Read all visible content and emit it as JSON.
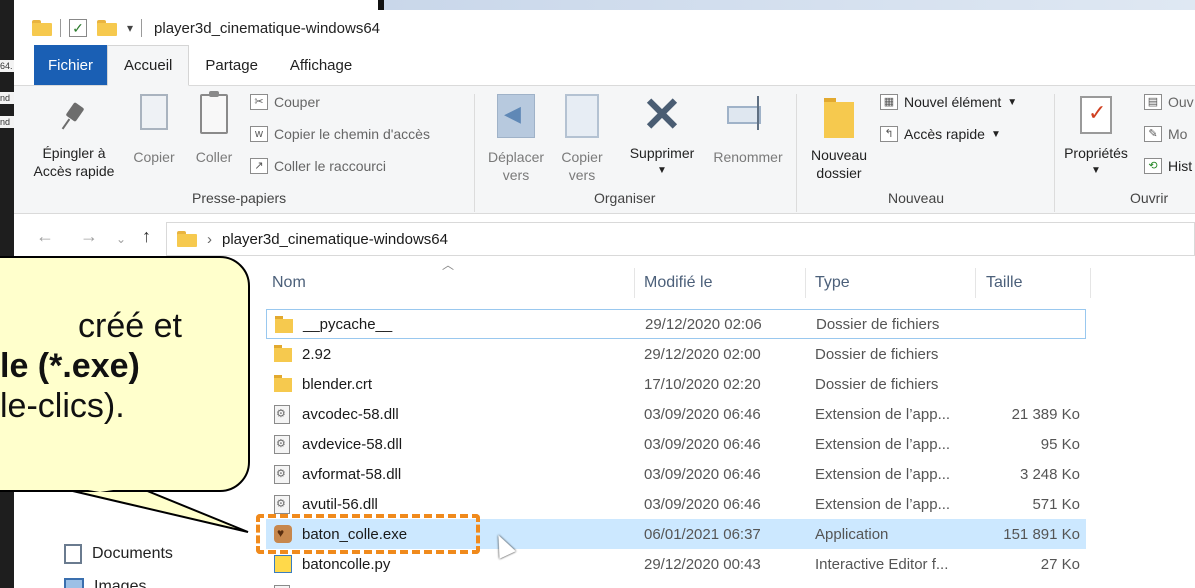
{
  "window": {
    "title": "player3d_cinematique-windows64"
  },
  "background_fragments": [
    "64.",
    "nd",
    "nd"
  ],
  "tabs": [
    {
      "label": "Fichier"
    },
    {
      "label": "Accueil"
    },
    {
      "label": "Partage"
    },
    {
      "label": "Affichage"
    }
  ],
  "ribbon": {
    "pin": {
      "line1": "Épingler à",
      "line2": "Accès rapide"
    },
    "copy": "Copier",
    "paste": "Coller",
    "cut": "Couper",
    "copy_path": "Copier le chemin d'accès",
    "paste_shortcut": "Coller le raccourci",
    "group_clipboard": "Presse-papiers",
    "move_to": {
      "line1": "Déplacer",
      "line2": "vers"
    },
    "copy_to": {
      "line1": "Copier",
      "line2": "vers"
    },
    "delete": "Supprimer",
    "rename": "Renommer",
    "group_organize": "Organiser",
    "new_folder": {
      "line1": "Nouveau",
      "line2": "dossier"
    },
    "new_item": "Nouvel élément",
    "easy_access": "Accès rapide",
    "group_new": "Nouveau",
    "properties": "Propriétés",
    "open_partial": "Ouv",
    "modify_partial": "Mo",
    "history_partial": "Hist",
    "group_open": "Ouvrir"
  },
  "address": {
    "path": "player3d_cinematique-windows64"
  },
  "columns": {
    "name": "Nom",
    "modified": "Modifié le",
    "type": "Type",
    "size": "Taille"
  },
  "files": [
    {
      "name": "__pycache__",
      "modified": "29/12/2020 02:06",
      "type": "Dossier de fichiers",
      "size": "",
      "icon": "folder-icon"
    },
    {
      "name": "2.92",
      "modified": "29/12/2020 02:00",
      "type": "Dossier de fichiers",
      "size": "",
      "icon": "folder-icon"
    },
    {
      "name": "blender.crt",
      "modified": "17/10/2020 02:20",
      "type": "Dossier de fichiers",
      "size": "",
      "icon": "folder-icon"
    },
    {
      "name": "avcodec-58.dll",
      "modified": "03/09/2020 06:46",
      "type": "Extension de l’app...",
      "size": "21 389 Ko",
      "icon": "dll-icon"
    },
    {
      "name": "avdevice-58.dll",
      "modified": "03/09/2020 06:46",
      "type": "Extension de l’app...",
      "size": "95 Ko",
      "icon": "dll-icon"
    },
    {
      "name": "avformat-58.dll",
      "modified": "03/09/2020 06:46",
      "type": "Extension de l’app...",
      "size": "3 248 Ko",
      "icon": "dll-icon"
    },
    {
      "name": "avutil-56.dll",
      "modified": "03/09/2020 06:46",
      "type": "Extension de l’app...",
      "size": "571 Ko",
      "icon": "dll-icon"
    },
    {
      "name": "baton_colle.exe",
      "modified": "06/01/2021 06:37",
      "type": "Application",
      "size": "151 891 Ko",
      "icon": "exe-icon"
    },
    {
      "name": "batoncolle.py",
      "modified": "29/12/2020 00:43",
      "type": "Interactive Editor f...",
      "size": "27 Ko",
      "icon": "python-file-icon"
    }
  ],
  "nav": {
    "documents": "Documents",
    "images_partial": "Images"
  },
  "callout": {
    "line1": "créé et",
    "line2": "le (*.exe)",
    "line3": "le-clics)."
  },
  "colors": {
    "file_tab": "#1a5fb4",
    "selection": "#cce8ff",
    "highlight": "#f08a1c",
    "callout_bg": "#ffffcc"
  }
}
